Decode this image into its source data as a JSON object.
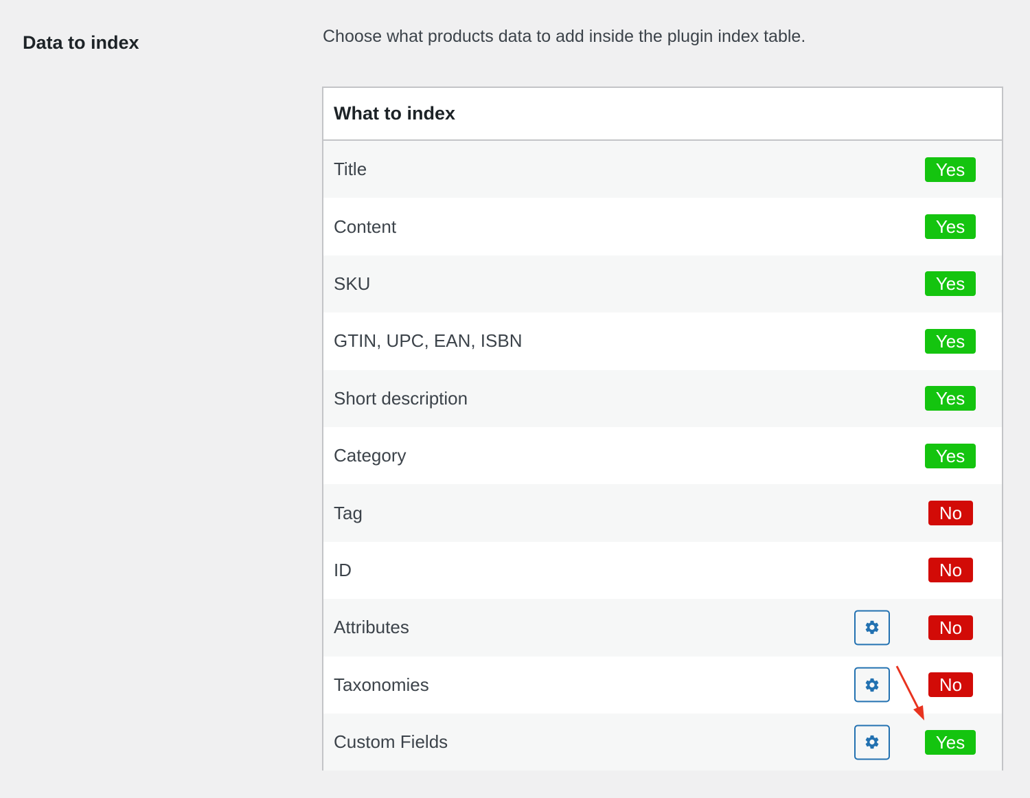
{
  "section": {
    "label": "Data to index",
    "description": "Choose what products data to add inside the plugin index table."
  },
  "table": {
    "header": "What to index",
    "rows": [
      {
        "label": "Title",
        "status": "Yes",
        "has_settings": false
      },
      {
        "label": "Content",
        "status": "Yes",
        "has_settings": false
      },
      {
        "label": "SKU",
        "status": "Yes",
        "has_settings": false
      },
      {
        "label": "GTIN, UPC, EAN, ISBN",
        "status": "Yes",
        "has_settings": false
      },
      {
        "label": "Short description",
        "status": "Yes",
        "has_settings": false
      },
      {
        "label": "Category",
        "status": "Yes",
        "has_settings": false
      },
      {
        "label": "Tag",
        "status": "No",
        "has_settings": false
      },
      {
        "label": "ID",
        "status": "No",
        "has_settings": false
      },
      {
        "label": "Attributes",
        "status": "No",
        "has_settings": true
      },
      {
        "label": "Taxonomies",
        "status": "No",
        "has_settings": true
      },
      {
        "label": "Custom Fields",
        "status": "Yes",
        "has_settings": true
      }
    ]
  },
  "icons": {
    "settings": "gear-icon",
    "annotation": "red-arrow-icon"
  },
  "colors": {
    "yes": "#14c40f",
    "no": "#d20b07",
    "accent": "#2271b1",
    "annotation": "#e8331f"
  }
}
